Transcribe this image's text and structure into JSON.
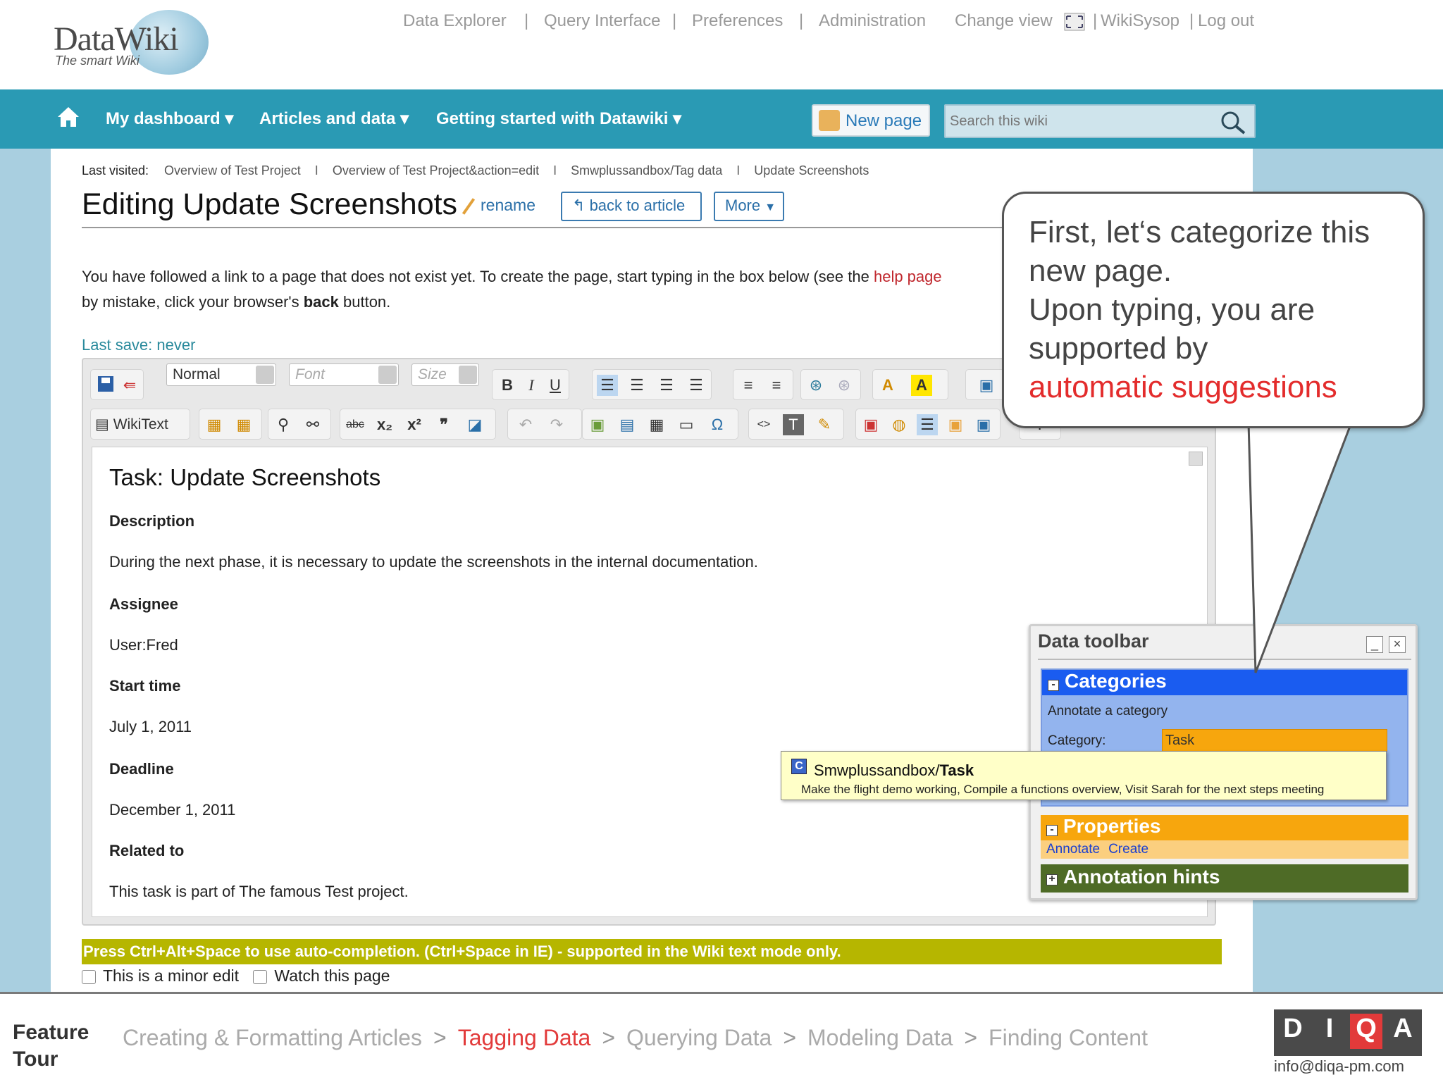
{
  "header": {
    "logo_title": "DataWiki",
    "logo_tagline": "The smart Wiki",
    "links": [
      "Data Explorer",
      "Query Interface",
      "Preferences",
      "Administration"
    ],
    "change_view": "Change view",
    "user": "WikiSysop",
    "logout": "Log out"
  },
  "nav": {
    "items": [
      "My dashboard",
      "Articles and data",
      "Getting started with Datawiki"
    ],
    "new_page": "New page",
    "search_placeholder": "Search this wiki"
  },
  "breadcrumb": {
    "label": "Last visited:",
    "items": [
      "Overview of Test Project",
      "Overview of Test Project&action=edit",
      "Smwplussandbox/Tag data",
      "Update Screenshots"
    ]
  },
  "page": {
    "title": "Editing Update Screenshots",
    "rename": "rename",
    "back_to_article": "back to article",
    "more": "More",
    "info_line1_a": "You have followed a link to a page that does not exist yet. To create the page, start typing in the box below (see the ",
    "info_line1_link": "help page",
    "info_line2_a": "by mistake, click your browser's ",
    "info_line2_bold": "back",
    "info_line2_b": " button.",
    "last_save": "Last save: never"
  },
  "toolbar": {
    "format": "Normal",
    "font": "Font",
    "size": "Size",
    "wikitext": "WikiText"
  },
  "editor": {
    "heading": "Task: Update Screenshots",
    "description_label": "Description",
    "description": "During the next phase, it is necessary to update the screenshots in the internal documentation.",
    "assignee_label": "Assignee",
    "assignee": "User:Fred",
    "start_label": "Start time",
    "start": "July 1, 2011",
    "deadline_label": "Deadline",
    "deadline": "December 1, 2011",
    "related_label": "Related to",
    "related": "This task is part of The famous Test project."
  },
  "hint_bar": "Press Ctrl+Alt+Space to use auto-completion. (Ctrl+Space in IE) - supported in the Wiki text mode only.",
  "checkboxes": {
    "minor_edit": "This is a minor edit",
    "watch": "Watch this page"
  },
  "callout": {
    "line1": "First, let‘s categorize this new page.",
    "line2": "Upon typing, you are supported by",
    "highlight": "automatic suggestions",
    "highlight_color": "#e32c2c"
  },
  "data_toolbar": {
    "title": "Data toolbar",
    "categories": "Categories",
    "annotate_category": "Annotate a category",
    "category_label": "Category:",
    "category_value": "Task",
    "properties": "Properties",
    "annotate": "Annotate",
    "create": "Create",
    "annotation_hints": "Annotation hints"
  },
  "suggestion": {
    "icon": "C",
    "prefix": "Smwplussandbox/",
    "name": "Task",
    "detail": "Make the flight demo working, Compile a functions overview, Visit Sarah for the next steps meeting"
  },
  "footer": {
    "label_line1": "Feature",
    "label_line2": "Tour",
    "steps": [
      "Creating & Formatting Articles",
      "Tagging Data",
      "Querying Data",
      "Modeling Data",
      "Finding Content"
    ],
    "current_step": "Tagging Data",
    "brand_letters": [
      "D",
      "I",
      "Q",
      "A"
    ],
    "email": "info@diqa-pm.com"
  },
  "colors": {
    "nav_bg": "#2a9ab4",
    "categories_header": "#1a5cf0",
    "properties_header": "#f7a60d",
    "hints_header": "#4e6b26",
    "hint_bar": "#b6b600"
  }
}
